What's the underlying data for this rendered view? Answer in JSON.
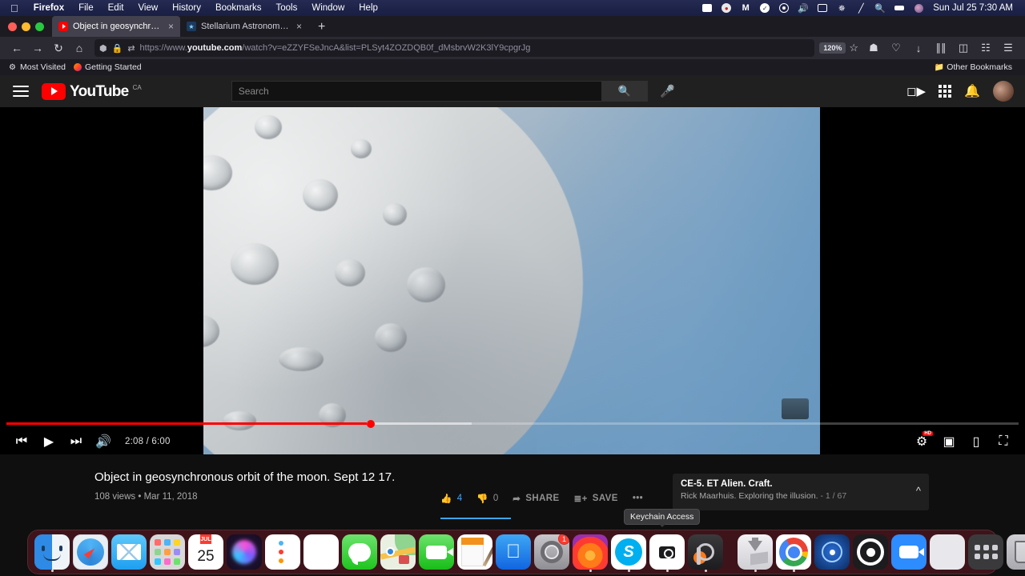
{
  "menubar": {
    "apple": "",
    "items": [
      {
        "label": "Firefox",
        "bold": true
      },
      {
        "label": "File",
        "bold": false
      },
      {
        "label": "Edit",
        "bold": false
      },
      {
        "label": "View",
        "bold": false
      },
      {
        "label": "History",
        "bold": false
      },
      {
        "label": "Bookmarks",
        "bold": false
      },
      {
        "label": "Tools",
        "bold": false
      },
      {
        "label": "Window",
        "bold": false
      },
      {
        "label": "Help",
        "bold": false
      }
    ],
    "status_icons": [
      "zoom-icon",
      "malwarebytes-icon",
      "m-icon",
      "check-icon",
      "record-icon",
      "volume-icon",
      "battery-icon",
      "bluetooth-icon",
      "wifi-off-icon",
      "search-icon",
      "display-icon",
      "user-icon"
    ],
    "clock": "Sun Jul 25  7:30 AM"
  },
  "browser": {
    "tabs": [
      {
        "title": "Object in geosynchronous orbit",
        "favicon": "youtube-favicon",
        "active": true
      },
      {
        "title": "Stellarium Astronomy Software",
        "favicon": "stellarium-favicon",
        "active": false
      }
    ],
    "new_tab_label": "+",
    "nav": {
      "back": "←",
      "forward": "→",
      "reload": "↻",
      "home": "⌂"
    },
    "url_prefix": "https://www.",
    "url_domain": "youtube.com",
    "url_suffix": "/watch?v=eZZYFSeJncA&list=PLSyt4ZOZDQB0f_dMsbrvW2K3lY9cpgrJg",
    "zoom_level": "120%",
    "bookmarks": [
      {
        "label": "Most Visited",
        "icon": "gear-icon"
      },
      {
        "label": "Getting Started",
        "icon": "firefox-icon"
      }
    ],
    "other_bookmarks": "Other Bookmarks",
    "toolbar_icons": [
      "pocket-icon",
      "shield-icon",
      "downloads-icon",
      "library-icon",
      "sidebar-icon",
      "grid-icon",
      "menu-icon"
    ]
  },
  "youtube": {
    "logo_word": "YouTube",
    "country_code": "CA",
    "search": {
      "placeholder": "Search",
      "value": ""
    },
    "header_icons": [
      "create-video-icon",
      "apps-grid-icon",
      "notifications-bell-icon",
      "avatar"
    ],
    "player": {
      "current_time": "2:08",
      "duration": "6:00",
      "time_display": "2:08 / 6:00",
      "progress_percent": 35.6,
      "loaded_percent": 46,
      "quality_badge": "HD",
      "controls": [
        "previous-icon",
        "play-icon",
        "next-icon",
        "volume-icon"
      ],
      "right_controls": [
        "settings-gear-icon",
        "miniplayer-icon",
        "theater-mode-icon",
        "fullscreen-icon"
      ],
      "watermark": "watermark"
    },
    "video": {
      "title": "Object in geosynchronous orbit of the moon. Sept 12 17.",
      "views": "108 views",
      "separator": "•",
      "date": "Mar 11, 2018"
    },
    "actions": [
      {
        "name": "like",
        "icon": "thumbs-up-icon",
        "count": "4",
        "liked": true
      },
      {
        "name": "dislike",
        "icon": "thumbs-down-icon",
        "count": "0",
        "liked": false
      },
      {
        "name": "share",
        "icon": "share-icon",
        "label": "SHARE"
      },
      {
        "name": "save",
        "icon": "save-icon",
        "label": "SAVE"
      },
      {
        "name": "more",
        "icon": "more-icon",
        "label": "•••"
      }
    ],
    "playlist": {
      "title": "CE-5. ET Alien. Craft.",
      "author": "Rick Maarhuis. Exploring the illusion.",
      "index": "1 / 67",
      "dash": "-"
    }
  },
  "tooltip": {
    "label": "Keychain Access"
  },
  "dock": {
    "items": [
      {
        "name": "finder",
        "running": true
      },
      {
        "name": "safari",
        "running": false
      },
      {
        "name": "mail",
        "running": false
      },
      {
        "name": "launchpad",
        "running": false
      },
      {
        "name": "calendar",
        "month": "JUL",
        "day": "25",
        "running": false
      },
      {
        "name": "siri",
        "running": false
      },
      {
        "name": "reminders",
        "running": false
      },
      {
        "name": "notes",
        "running": false
      },
      {
        "name": "messages",
        "running": false
      },
      {
        "name": "maps",
        "running": false
      },
      {
        "name": "facetime",
        "running": false
      },
      {
        "name": "pages",
        "running": false
      },
      {
        "name": "app-store",
        "running": false
      },
      {
        "name": "system-preferences",
        "badge": "1",
        "running": false
      },
      {
        "name": "firefox",
        "running": true
      },
      {
        "name": "skype",
        "running": true
      },
      {
        "name": "screenshot",
        "running": true
      },
      {
        "name": "keychain-access",
        "running": true
      },
      {
        "name": "stuffit-expander",
        "running": true
      },
      {
        "name": "chrome",
        "running": true
      },
      {
        "name": "atom",
        "running": false
      },
      {
        "name": "obs",
        "running": false
      },
      {
        "name": "zoom",
        "running": false
      },
      {
        "name": "window-manager",
        "running": false
      },
      {
        "name": "grid-app",
        "running": false
      },
      {
        "name": "trash",
        "running": false
      }
    ]
  }
}
